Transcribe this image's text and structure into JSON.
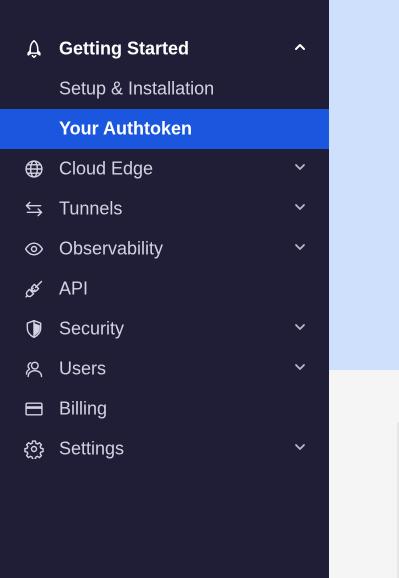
{
  "sidebar": {
    "sections": {
      "getting_started": {
        "label": "Getting Started",
        "icon": "rocket-icon",
        "expanded": true,
        "children": [
          {
            "label": "Setup & Installation"
          },
          {
            "label": "Your Authtoken",
            "active": true
          }
        ]
      },
      "cloud_edge": {
        "label": "Cloud Edge",
        "icon": "globe-icon"
      },
      "tunnels": {
        "label": "Tunnels",
        "icon": "arrows-swap-icon"
      },
      "observability": {
        "label": "Observability",
        "icon": "eye-icon"
      },
      "api": {
        "label": "API",
        "icon": "plug-icon"
      },
      "security": {
        "label": "Security",
        "icon": "shield-icon"
      },
      "users": {
        "label": "Users",
        "icon": "users-icon"
      },
      "billing": {
        "label": "Billing",
        "icon": "credit-card-icon"
      },
      "settings": {
        "label": "Settings",
        "icon": "gear-icon"
      }
    }
  },
  "colors": {
    "sidebar_bg": "#1f1e36",
    "active_bg": "#1a57de",
    "text": "#d2d3e2",
    "main_top_bg": "#cfe0fd",
    "main_bottom_bg": "#f5f5f6"
  }
}
